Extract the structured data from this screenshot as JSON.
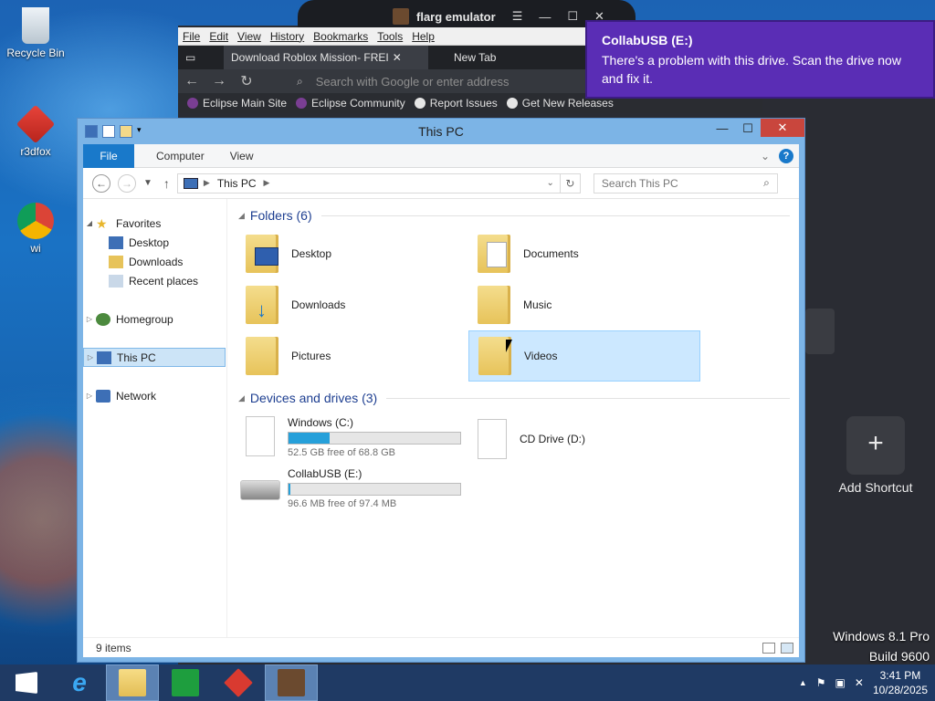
{
  "desktop": {
    "icons": [
      {
        "label": "Recycle Bin"
      },
      {
        "label": "r3dfox"
      },
      {
        "label": "wi"
      }
    ]
  },
  "browser": {
    "app_title": "flarg emulator",
    "menu": [
      "File",
      "Edit",
      "View",
      "History",
      "Bookmarks",
      "Tools",
      "Help"
    ],
    "tabs": [
      {
        "label": "Download Roblox Mission- FREI"
      },
      {
        "label": "New Tab"
      }
    ],
    "url_placeholder": "Search with Google or enter address",
    "bookmarks": [
      {
        "label": "Eclipse Main Site"
      },
      {
        "label": "Eclipse Community"
      },
      {
        "label": "Report Issues"
      },
      {
        "label": "Get New Releases"
      }
    ],
    "add_shortcut_label": "Add Shortcut"
  },
  "notification": {
    "title": "CollabUSB (E:)",
    "message": "There's a problem with this drive.  Scan the drive now and fix it."
  },
  "explorer": {
    "title": "This PC",
    "ribbon_tabs": [
      "File",
      "Computer",
      "View"
    ],
    "address": "This PC",
    "search_placeholder": "Search This PC",
    "nav": {
      "favorites": "Favorites",
      "favorites_items": [
        "Desktop",
        "Downloads",
        "Recent places"
      ],
      "homegroup": "Homegroup",
      "this_pc": "This PC",
      "network": "Network"
    },
    "folders_header": "Folders (6)",
    "folders": [
      {
        "label": "Desktop"
      },
      {
        "label": "Documents"
      },
      {
        "label": "Downloads"
      },
      {
        "label": "Music"
      },
      {
        "label": "Pictures"
      },
      {
        "label": "Videos"
      }
    ],
    "devices_header": "Devices and drives (3)",
    "drives": [
      {
        "label": "Windows (C:)",
        "free": "52.5 GB free of 68.8 GB",
        "used_fraction": 0.237
      },
      {
        "label": "CD Drive (D:)"
      },
      {
        "label": "CollabUSB (E:)",
        "free": "96.6 MB free of 97.4 MB",
        "used_fraction": 0.008
      }
    ],
    "status": "9 items"
  },
  "overlay": {
    "windows_version": "Windows 8.1 Pro",
    "build": "Build 9600"
  },
  "taskbar": {
    "time": "3:41 PM",
    "date": "10/28/2025"
  },
  "colors": {
    "notification_bg": "#5a2db5",
    "accent": "#1979ca",
    "close_button": "#c9463d",
    "drive_bar": "#26a0da"
  }
}
